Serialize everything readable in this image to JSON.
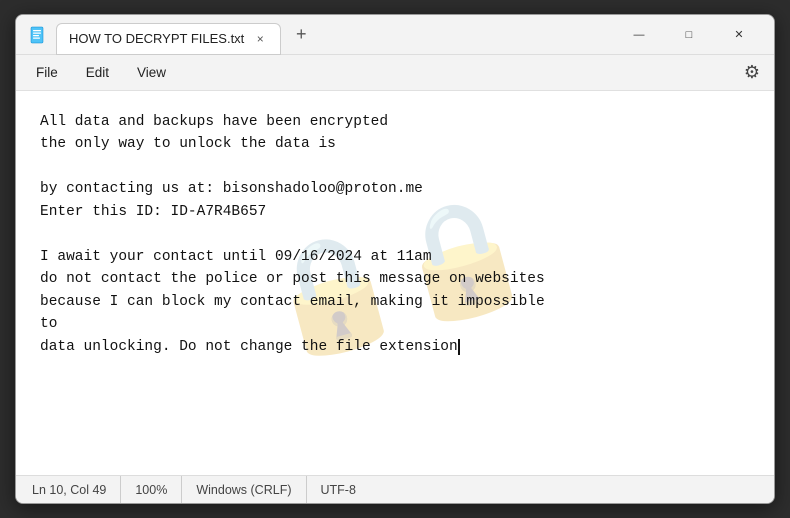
{
  "window": {
    "title": "HOW TO DECRYPT FILES.txt",
    "icon": "notepad-icon"
  },
  "titlebar": {
    "tab_label": "HOW TO DECRYPT FILES.txt",
    "tab_close": "×",
    "new_tab": "+",
    "minimize": "—",
    "maximize": "□",
    "close": "✕"
  },
  "menubar": {
    "file": "File",
    "edit": "Edit",
    "view": "View"
  },
  "watermark": {
    "text": "🔒🔒"
  },
  "content": {
    "text_line1": "All data and backups have been encrypted",
    "text_line2": "the only way to unlock the data is",
    "text_line3": "",
    "text_line4": "by contacting us at: bisonshadoloo@proton.me",
    "text_line5": "Enter this ID: ID-A7R4B657",
    "text_line6": "",
    "text_line7": "I await your contact until 09/16/2024 at 11am",
    "text_line8": "do not contact the police or post this message on websites",
    "text_line9": "because I can block my contact email, making it impossible",
    "text_line10": "to",
    "text_line11_no_cursor": "data unlocking. Do not change the file extension"
  },
  "statusbar": {
    "position": "Ln 10, Col 49",
    "zoom": "100%",
    "line_ending": "Windows (CRLF)",
    "encoding": "UTF-8"
  }
}
